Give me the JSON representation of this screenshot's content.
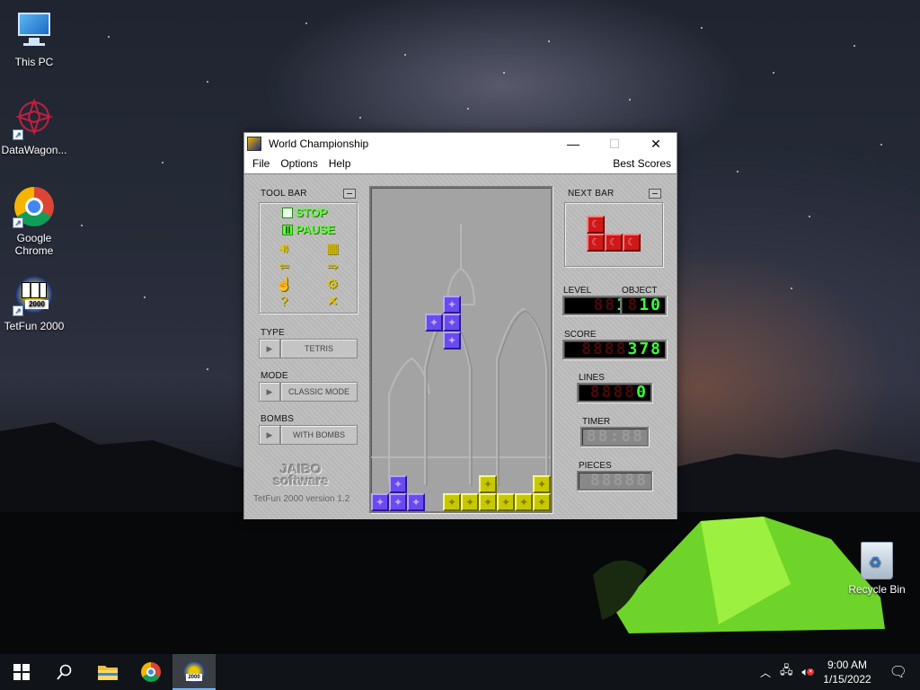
{
  "desktop": {
    "icons": [
      {
        "label": "This PC"
      },
      {
        "label": "DataWagon..."
      },
      {
        "label": "Google Chrome"
      },
      {
        "label": "TetFun 2000"
      }
    ],
    "recycle_bin": "Recycle Bin"
  },
  "window": {
    "title": "World Championship",
    "controls": {
      "minimize": "—",
      "maximize": "☐",
      "close": "✕"
    },
    "menu": [
      "File",
      "Options",
      "Help"
    ],
    "menu_right": "Best Scores"
  },
  "game": {
    "toolbar_title": "TOOL BAR",
    "stop_label": "STOP",
    "pause_label": "PAUSE",
    "type_label": "TYPE",
    "type_value": "TETRIS",
    "mode_label": "MODE",
    "mode_value": "CLASSIC MODE",
    "bombs_label": "BOMBS",
    "bombs_value": "WITH BOMBS",
    "logo_line1": "JAIBO",
    "logo_line2": "software",
    "version": "TetFun 2000 version 1.2",
    "next_bar_title": "NEXT BAR",
    "level_label": "LEVEL",
    "level_value": "1",
    "object_label": "OBJECT",
    "object_value": "10",
    "score_label": "SCORE",
    "score_value": "378",
    "lines_label": "LINES",
    "lines_value": "0",
    "timer_label": "TIMER",
    "pieces_label": "PIECES",
    "colors": {
      "purple": "#6a4af0",
      "yellow": "#c8c800",
      "red": "#d01818",
      "led_green": "#3cff3c"
    }
  },
  "taskbar": {
    "time": "9:00 AM",
    "date": "1/15/2022"
  }
}
